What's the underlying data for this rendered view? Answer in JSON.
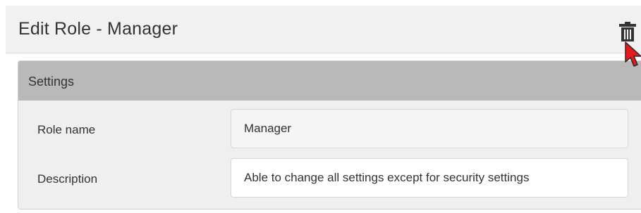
{
  "dialog": {
    "title": "Edit Role - Manager",
    "delete_icon": "trash-icon",
    "cursor_icon": "mouse-pointer-icon"
  },
  "settings": {
    "header": "Settings",
    "fields": [
      {
        "label": "Role name",
        "value": "Manager"
      },
      {
        "label": "Description",
        "value": "Able to change all settings except for security settings"
      }
    ]
  },
  "colors": {
    "header_bg": "#f1f1f1",
    "panel_header_bg": "#b9b9b9",
    "panel_bg": "#efefef",
    "cursor": "#e8191b"
  }
}
